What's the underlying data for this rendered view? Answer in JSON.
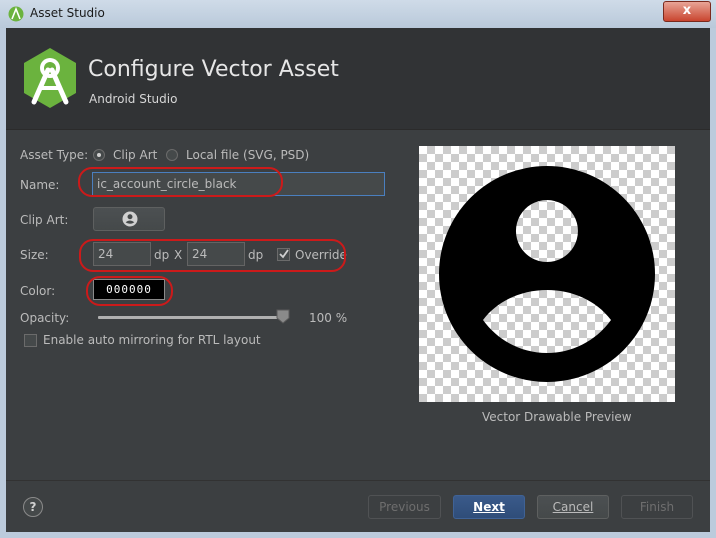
{
  "window": {
    "title": "Asset Studio",
    "close_glyph": "x"
  },
  "header": {
    "title": "Configure Vector Asset",
    "subtitle": "Android Studio",
    "logo_icon": "android-studio-icon"
  },
  "form": {
    "asset_type_label": "Asset Type:",
    "asset_type_options": [
      "Clip Art",
      "Local file (SVG, PSD)"
    ],
    "asset_type_selected": "Clip Art",
    "name_label": "Name:",
    "name_value": "ic_account_circle_black",
    "clip_art_label": "Clip Art:",
    "clip_art_icon": "account-circle-icon",
    "size_label": "Size:",
    "width_value": "24",
    "height_value": "24",
    "unit_dp": "dp",
    "size_separator": "X",
    "override_label": "Override",
    "override_checked": true,
    "color_label": "Color:",
    "color_value": "000000",
    "opacity_label": "Opacity:",
    "opacity_value": "100 %",
    "opacity_fraction": 1.0,
    "rtl_label": "Enable auto mirroring for RTL layout",
    "rtl_checked": false
  },
  "preview": {
    "caption": "Vector Drawable Preview",
    "icon": "account-circle-icon"
  },
  "footer": {
    "help": "?",
    "previous": "Previous",
    "next": "Next",
    "cancel": "Cancel",
    "finish": "Finish"
  },
  "colors": {
    "highlight": "#cc1a1a",
    "primary_button": "#2f4d79",
    "background": "#3c3f41"
  }
}
